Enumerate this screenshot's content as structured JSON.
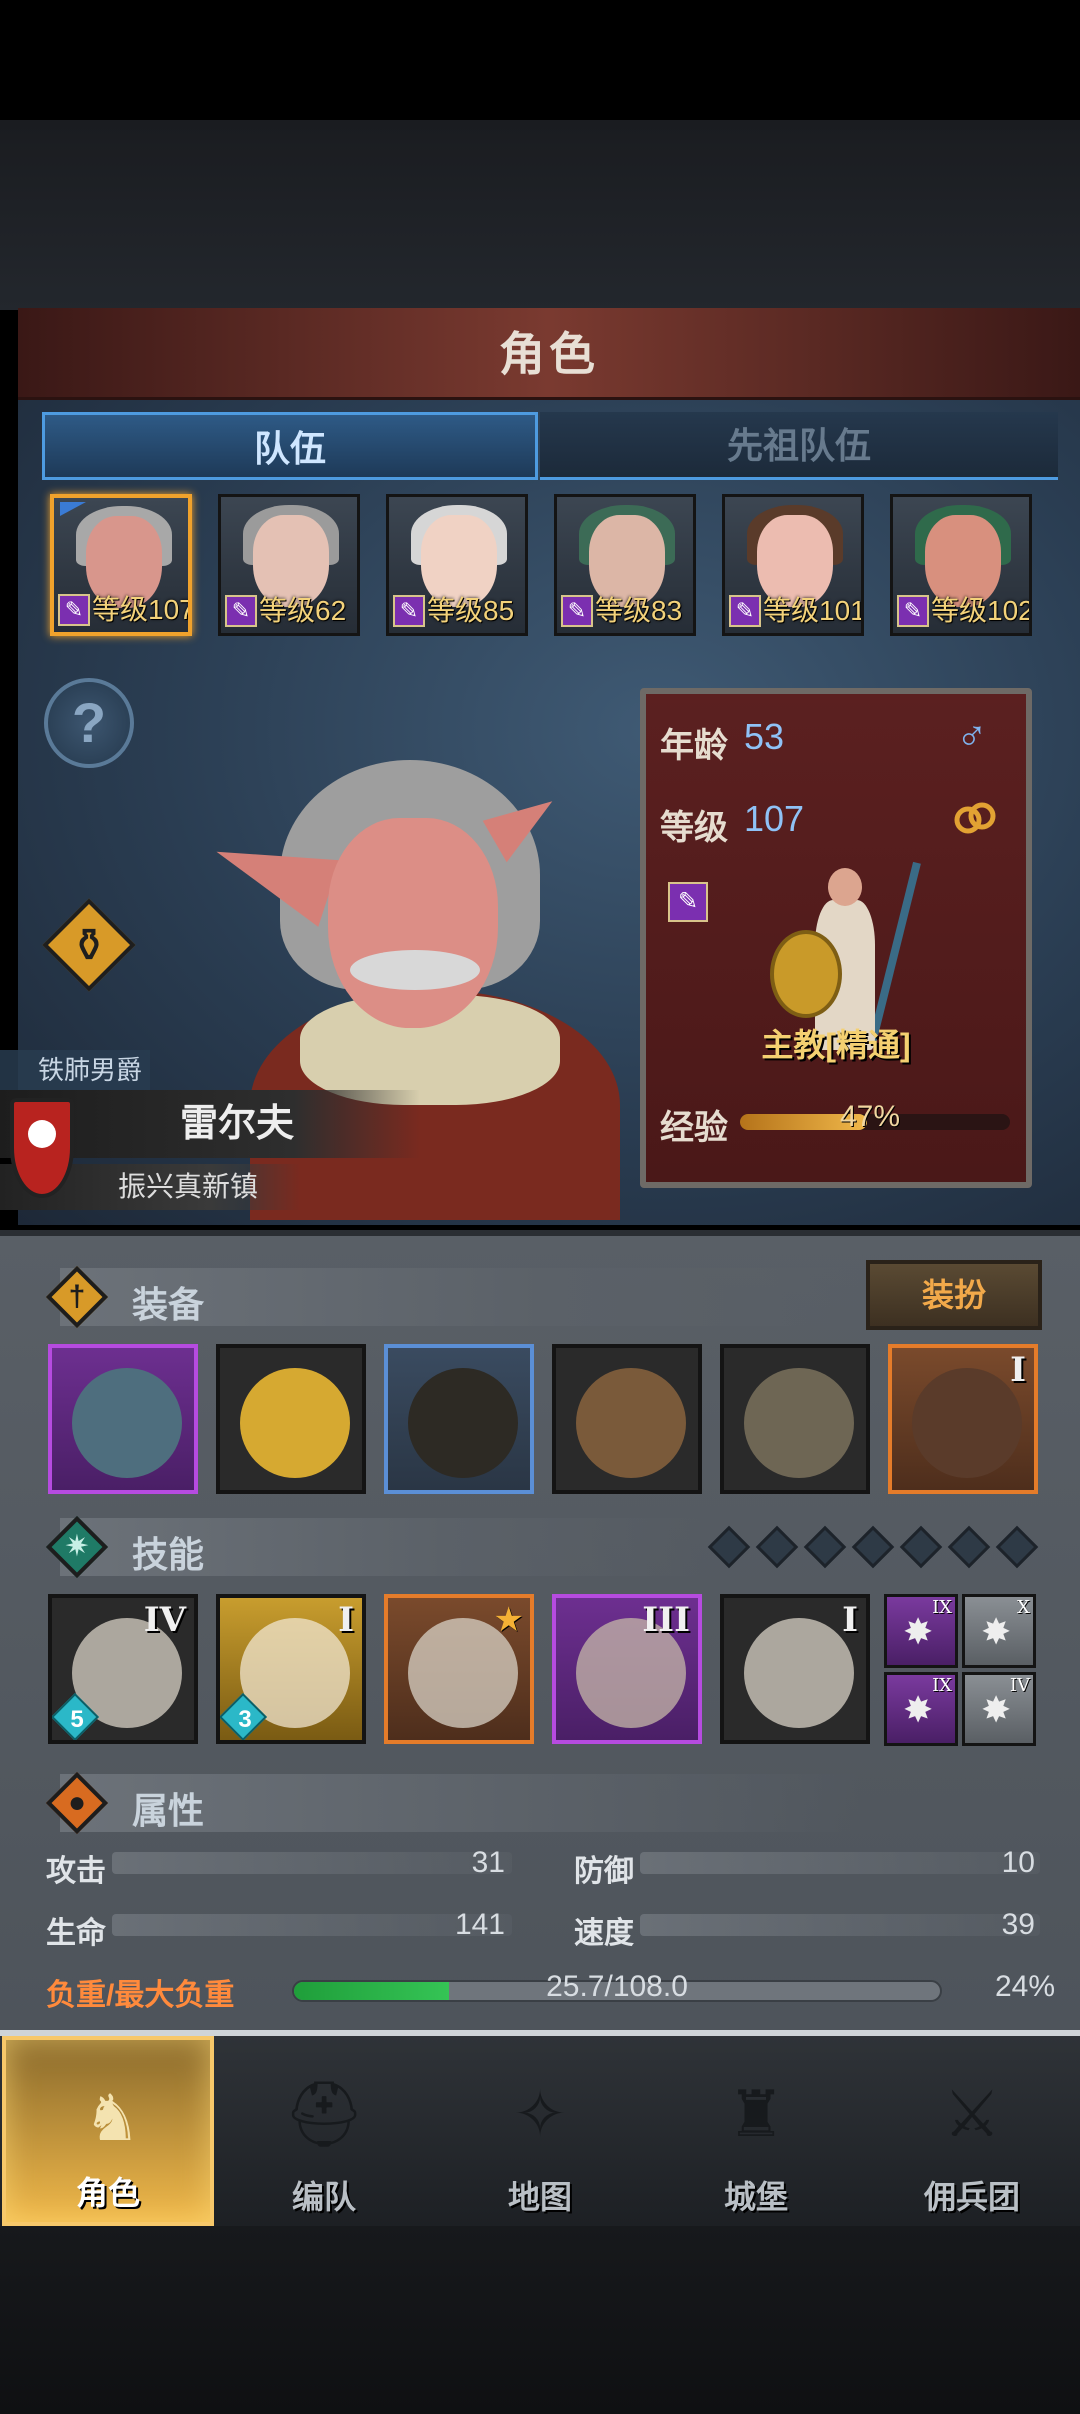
{
  "header": {
    "title": "角色"
  },
  "tabs": [
    {
      "label": "队伍",
      "active": true
    },
    {
      "label": "先祖队伍",
      "active": false
    }
  ],
  "party": [
    {
      "level_text": "等级107",
      "selected": true,
      "hair": "#a8a8a8",
      "skin": "#d8968c"
    },
    {
      "level_text": "等级62",
      "selected": false,
      "hair": "#9b9b9b",
      "skin": "#e4c1b4"
    },
    {
      "level_text": "等级85",
      "selected": false,
      "hair": "#d6d6d6",
      "skin": "#f0d2c4"
    },
    {
      "level_text": "等级83",
      "selected": false,
      "hair": "#3c6b56",
      "skin": "#dcb6a6"
    },
    {
      "level_text": "等级101",
      "selected": false,
      "hair": "#5a3b2a",
      "skin": "#ecbcb0"
    },
    {
      "level_text": "等级102",
      "selected": false,
      "hair": "#2f6a4b",
      "skin": "#d8907e"
    }
  ],
  "help_icon": "?",
  "character": {
    "title": "铁肺男爵",
    "name": "雷尔夫",
    "town": "振兴真新镇",
    "age_label": "年龄",
    "age": "53",
    "gender_icon": "♂",
    "level_label": "等级",
    "level": "107",
    "ring_icon": "ring-icon",
    "class_name": "主教[精通]",
    "exp_label": "经验",
    "exp_percent_text": "47%",
    "exp_fraction": 0.47
  },
  "equipment": {
    "label": "装备",
    "dress_button": "装扮",
    "slots": [
      {
        "name": "staff",
        "style": "purple",
        "badge": ""
      },
      {
        "name": "golden-shield",
        "style": "",
        "badge": ""
      },
      {
        "name": "hood",
        "style": "blue",
        "badge": ""
      },
      {
        "name": "tunic",
        "style": "",
        "badge": ""
      },
      {
        "name": "boots",
        "style": "",
        "badge": ""
      },
      {
        "name": "book",
        "style": "orange",
        "badge": "I"
      }
    ]
  },
  "skills": {
    "label": "技能",
    "pips": 7,
    "slots": [
      {
        "rank": "IV",
        "gem": "5",
        "style": ""
      },
      {
        "rank": "I",
        "gem": "3",
        "style": "gold"
      },
      {
        "rank": "",
        "gem": "",
        "style": "orange",
        "star": "★"
      },
      {
        "rank": "III",
        "gem": "",
        "style": "purple"
      },
      {
        "rank": "I",
        "gem": "",
        "style": ""
      }
    ],
    "small_slots": [
      {
        "rank": "IX",
        "style": "purple"
      },
      {
        "rank": "X",
        "style": ""
      },
      {
        "rank": "IX",
        "style": "purple"
      },
      {
        "rank": "IV",
        "style": ""
      }
    ]
  },
  "attributes": {
    "label": "属性",
    "attack_label": "攻击",
    "attack": "31",
    "defense_label": "防御",
    "defense": "10",
    "hp_label": "生命",
    "hp": "141",
    "speed_label": "速度",
    "speed": "39",
    "load_label": "负重/最大负重",
    "load_value": "25.7/108.0",
    "load_percent": "24%",
    "load_fraction": 0.24
  },
  "nav": [
    {
      "label": "角色",
      "icon": "knight-icon",
      "active": true
    },
    {
      "label": "编队",
      "icon": "helmet-icon",
      "active": false
    },
    {
      "label": "地图",
      "icon": "compass-icon",
      "active": false
    },
    {
      "label": "城堡",
      "icon": "castle-icon",
      "active": false
    },
    {
      "label": "佣兵团",
      "icon": "mercenary-icon",
      "active": false
    }
  ],
  "colors": {
    "accent_gold": "#f0a22c",
    "tab_blue": "#4e9be0",
    "load_green": "#1f9e3a",
    "load_label": "#ff8a3c"
  }
}
